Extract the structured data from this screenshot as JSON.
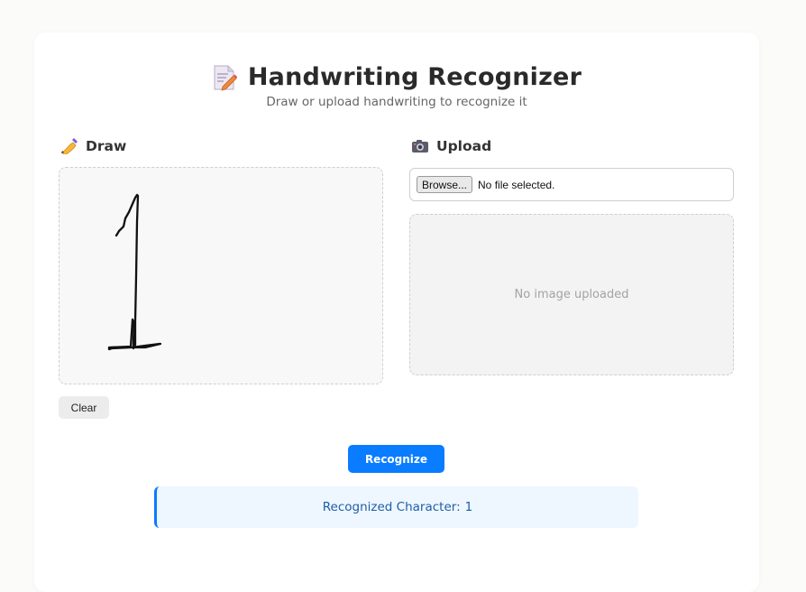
{
  "header": {
    "title": "Handwriting Recognizer",
    "subtitle": "Draw or upload handwriting to recognize it",
    "icon": "memo-pencil-icon"
  },
  "draw": {
    "heading": "Draw",
    "icon": "writing-hand-icon",
    "clear_label": "Clear"
  },
  "upload": {
    "heading": "Upload",
    "icon": "camera-icon",
    "browse_label": "Browse...",
    "file_status": "No file selected.",
    "preview_placeholder": "No image uploaded"
  },
  "actions": {
    "recognize_label": "Recognize"
  },
  "result": {
    "label": "Recognized Character:",
    "value": "1"
  },
  "colors": {
    "accent": "#0a7cff",
    "result_bg": "#eef6ff",
    "result_text": "#1d5fa6"
  }
}
